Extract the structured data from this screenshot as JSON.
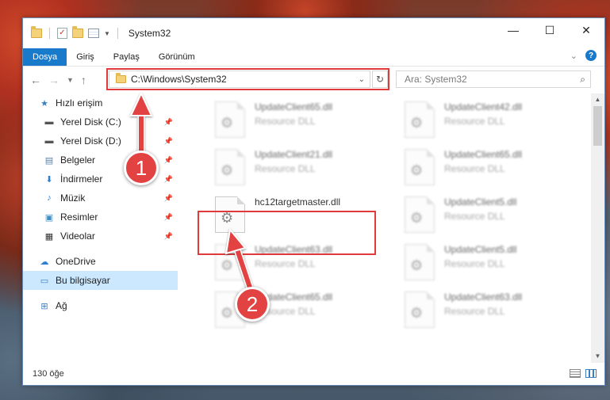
{
  "window": {
    "title": "System32",
    "controls": {
      "minimize": "—",
      "maximize": "☐",
      "close": "✕"
    }
  },
  "ribbon": {
    "tabs": [
      "Dosya",
      "Giriş",
      "Paylaş",
      "Görünüm"
    ],
    "active_tab": "Dosya",
    "help": "?"
  },
  "address": {
    "path": "C:\\Windows\\System32",
    "search_placeholder": "Ara: System32"
  },
  "nav": {
    "quick_access": "Hızlı erişim",
    "items": [
      {
        "label": "Yerel Disk (C:)",
        "icon": "drive-icon"
      },
      {
        "label": "Yerel Disk (D:)",
        "icon": "drive-icon"
      },
      {
        "label": "Belgeler",
        "icon": "documents-icon"
      },
      {
        "label": "İndirmeler",
        "icon": "download-icon"
      },
      {
        "label": "Müzik",
        "icon": "music-icon"
      },
      {
        "label": "Resimler",
        "icon": "pictures-icon"
      },
      {
        "label": "Videolar",
        "icon": "video-icon"
      }
    ],
    "onedrive": "OneDrive",
    "this_pc": "Bu bilgisayar",
    "network": "Ağ"
  },
  "files": [
    {
      "name": "UpdateClient65.dll",
      "type": "Resource DLL"
    },
    {
      "name": "UpdateClient42.dll",
      "type": "Resource DLL"
    },
    {
      "name": "UpdateClient21.dll",
      "type": "Resource DLL"
    },
    {
      "name": "UpdateClient65.dll",
      "type": "Resource DLL"
    },
    {
      "name": "hc12targetmaster.dll",
      "type": ""
    },
    {
      "name": "UpdateClient5.dll",
      "type": "Resource DLL"
    },
    {
      "name": "UpdateClient63.dll",
      "type": "Resource DLL"
    },
    {
      "name": "UpdateClient5.dll",
      "type": "Resource DLL"
    },
    {
      "name": "UpdateClient65.dll",
      "type": "Resource DLL"
    },
    {
      "name": "UpdateClient63.dll",
      "type": "Resource DLL"
    }
  ],
  "status": {
    "item_count": "130 öğe"
  },
  "annotations": {
    "step1": "1",
    "step2": "2",
    "color": "#e34242"
  }
}
